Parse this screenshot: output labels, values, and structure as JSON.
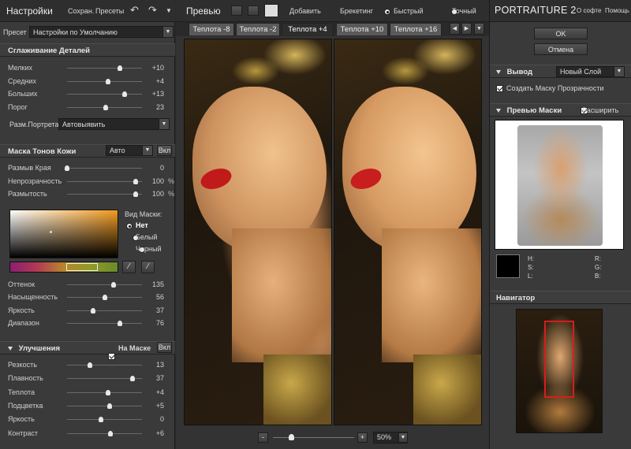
{
  "left_toolbar": {
    "title": "Настройки",
    "save": "Сохран.",
    "presets": "Пресеты"
  },
  "preset_row": {
    "label": "Пресет",
    "value": "Настройки по Умолчанию"
  },
  "detail_smoothing": {
    "title": "Сглаживание Деталей",
    "sliders": [
      {
        "label": "Мелких",
        "value": "+10",
        "level": 0.7
      },
      {
        "label": "Средних",
        "value": "+4",
        "level": 0.55
      },
      {
        "label": "Больших",
        "value": "+13",
        "level": 0.77
      },
      {
        "label": "Порог",
        "value": "23",
        "level": 0.52
      }
    ],
    "portrait_size_label": "Разм.Портрета",
    "portrait_size_value": "Автовыявить"
  },
  "skin_mask": {
    "title": "Маска Тонов Кожи",
    "mode": "Авто",
    "toggle": "Вкл",
    "sliders": [
      {
        "label": "Размыв Края",
        "value": "0",
        "unit": "",
        "level": 0.0
      },
      {
        "label": "Непрозрачность",
        "value": "100",
        "unit": "%",
        "level": 0.92
      },
      {
        "label": "Размытость",
        "value": "100",
        "unit": "%",
        "level": 0.92
      }
    ],
    "view_label": "Вид Маски:",
    "view_options": [
      "Нет",
      "Белый",
      "Черный"
    ],
    "view_selected": "Нет",
    "tone_sliders": [
      {
        "label": "Оттенок",
        "value": "135",
        "level": 0.62
      },
      {
        "label": "Насыщенность",
        "value": "56",
        "level": 0.5
      },
      {
        "label": "Яркость",
        "value": "37",
        "level": 0.35
      },
      {
        "label": "Диапазон",
        "value": "76",
        "level": 0.71
      }
    ]
  },
  "enhancements": {
    "title": "Улучшения",
    "on_mask": "На Маске",
    "toggle": "Вкл",
    "sliders": [
      {
        "label": "Резкость",
        "value": "13",
        "level": 0.3
      },
      {
        "label": "Плавность",
        "value": "37",
        "level": 0.87
      },
      {
        "label": "Теплота",
        "value": "+4",
        "level": 0.55
      },
      {
        "label": "Подцветка",
        "value": "+5",
        "level": 0.57
      },
      {
        "label": "Яркость",
        "value": "0",
        "level": 0.45
      },
      {
        "label": "Контраст",
        "value": "+6",
        "level": 0.58
      }
    ]
  },
  "preview_toolbar": {
    "title": "Превью",
    "add": "Добавить",
    "bracketing": "Брекетинг",
    "fast": "Быстрый",
    "precise": "Точный"
  },
  "tabs": [
    {
      "label": "Теплота -8",
      "active": false
    },
    {
      "label": "Теплота -2",
      "active": false
    },
    {
      "label": "Теплота +4",
      "active": true
    },
    {
      "label": "Теплота +10",
      "active": false
    },
    {
      "label": "Теплота +16",
      "active": false
    }
  ],
  "zoom": {
    "value": "50%",
    "minus": "-",
    "plus": "+"
  },
  "right_panel": {
    "brand": "PORTRAITURE 2",
    "about": "О софте",
    "help": "Помощь",
    "ok": "OK",
    "cancel": "Отмена",
    "output_label": "Вывод",
    "output_value": "Новый Слой",
    "create_mask": "Создать Маску Прозрачности",
    "mask_preview": "Превью Маски",
    "expand": "Расширить",
    "hsl_left": [
      "H:",
      "S:",
      "L:"
    ],
    "hsl_right": [
      "R:",
      "G:",
      "B:"
    ],
    "navigator": "Навигатор"
  },
  "colors": {
    "accent": "#c71a1a",
    "panel": "#3a3a3a",
    "swatch_orange": "#f29a1f"
  }
}
